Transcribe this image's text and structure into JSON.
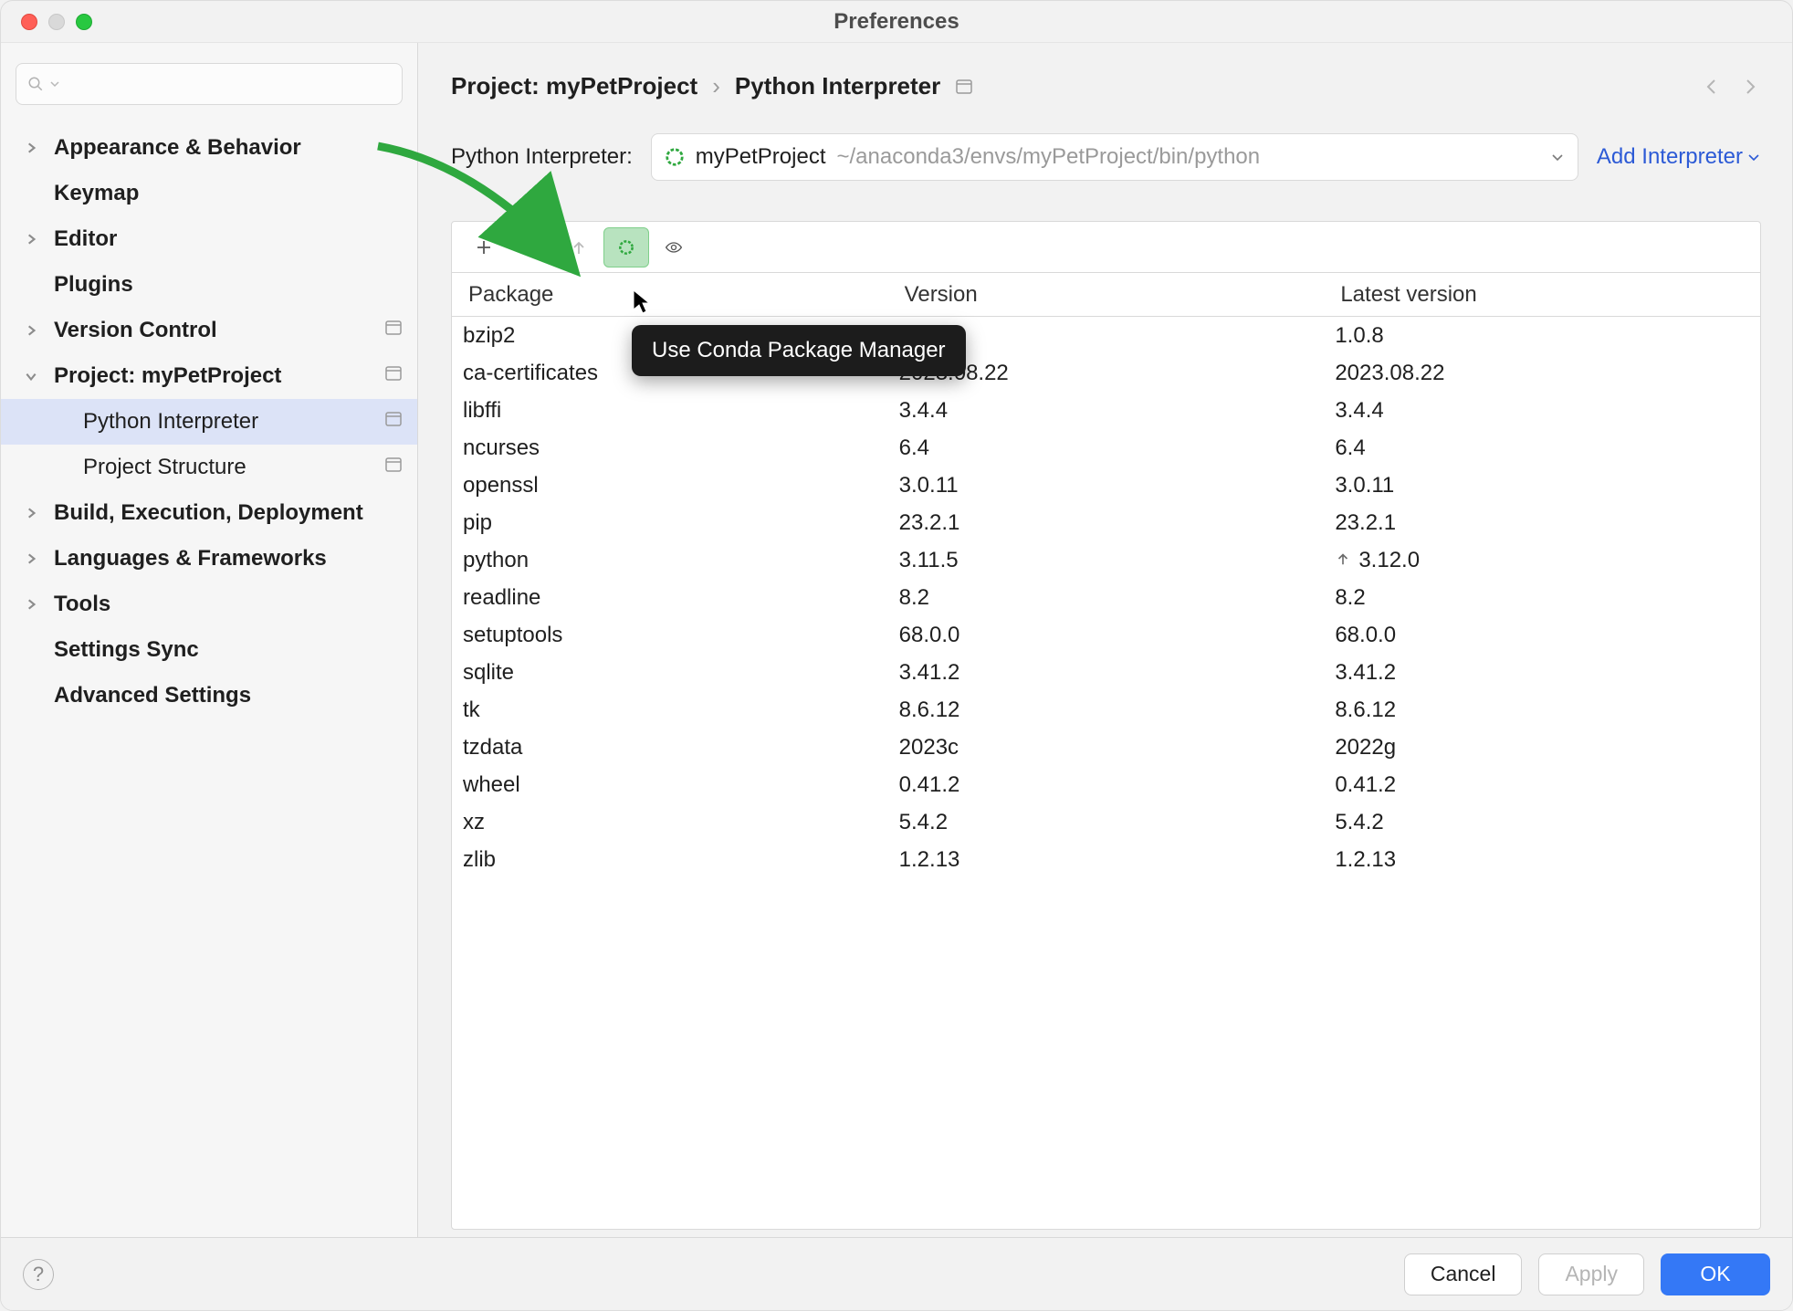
{
  "window": {
    "title": "Preferences"
  },
  "sidebar": {
    "search_placeholder": "",
    "items": [
      {
        "label": "Appearance & Behavior",
        "bold": true,
        "arrow": "right"
      },
      {
        "label": "Keymap",
        "bold": true,
        "arrow": "none"
      },
      {
        "label": "Editor",
        "bold": true,
        "arrow": "right"
      },
      {
        "label": "Plugins",
        "bold": true,
        "arrow": "none"
      },
      {
        "label": "Version Control",
        "bold": true,
        "arrow": "right",
        "cfg": true
      },
      {
        "label": "Project: myPetProject",
        "bold": true,
        "arrow": "down",
        "cfg": true
      },
      {
        "label": "Python Interpreter",
        "bold": false,
        "arrow": "child",
        "cfg": true,
        "selected": true
      },
      {
        "label": "Project Structure",
        "bold": false,
        "arrow": "child",
        "cfg": true
      },
      {
        "label": "Build, Execution, Deployment",
        "bold": true,
        "arrow": "right"
      },
      {
        "label": "Languages & Frameworks",
        "bold": true,
        "arrow": "right"
      },
      {
        "label": "Tools",
        "bold": true,
        "arrow": "right"
      },
      {
        "label": "Settings Sync",
        "bold": true,
        "arrow": "none"
      },
      {
        "label": "Advanced Settings",
        "bold": true,
        "arrow": "none"
      }
    ]
  },
  "breadcrumb": {
    "parent": "Project: myPetProject",
    "sep": "›",
    "current": "Python Interpreter"
  },
  "interpreter": {
    "label": "Python Interpreter:",
    "name": "myPetProject",
    "path": "~/anaconda3/envs/myPetProject/bin/python",
    "add_label": "Add Interpreter"
  },
  "tooltip": "Use Conda Package Manager",
  "table": {
    "headers": [
      "Package",
      "Version",
      "Latest version"
    ],
    "rows": [
      {
        "pkg": "bzip2",
        "ver": "",
        "latest": "1.0.8"
      },
      {
        "pkg": "ca-certificates",
        "ver": "2023.08.22",
        "latest": "2023.08.22"
      },
      {
        "pkg": "libffi",
        "ver": "3.4.4",
        "latest": "3.4.4"
      },
      {
        "pkg": "ncurses",
        "ver": "6.4",
        "latest": "6.4"
      },
      {
        "pkg": "openssl",
        "ver": "3.0.11",
        "latest": "3.0.11"
      },
      {
        "pkg": "pip",
        "ver": "23.2.1",
        "latest": "23.2.1"
      },
      {
        "pkg": "python",
        "ver": "3.11.5",
        "latest": "3.12.0",
        "upgrade": true
      },
      {
        "pkg": "readline",
        "ver": "8.2",
        "latest": "8.2"
      },
      {
        "pkg": "setuptools",
        "ver": "68.0.0",
        "latest": "68.0.0"
      },
      {
        "pkg": "sqlite",
        "ver": "3.41.2",
        "latest": "3.41.2"
      },
      {
        "pkg": "tk",
        "ver": "8.6.12",
        "latest": "8.6.12"
      },
      {
        "pkg": "tzdata",
        "ver": "2023c",
        "latest": "2022g"
      },
      {
        "pkg": "wheel",
        "ver": "0.41.2",
        "latest": "0.41.2"
      },
      {
        "pkg": "xz",
        "ver": "5.4.2",
        "latest": "5.4.2"
      },
      {
        "pkg": "zlib",
        "ver": "1.2.13",
        "latest": "1.2.13"
      }
    ]
  },
  "footer": {
    "cancel": "Cancel",
    "apply": "Apply",
    "ok": "OK"
  }
}
